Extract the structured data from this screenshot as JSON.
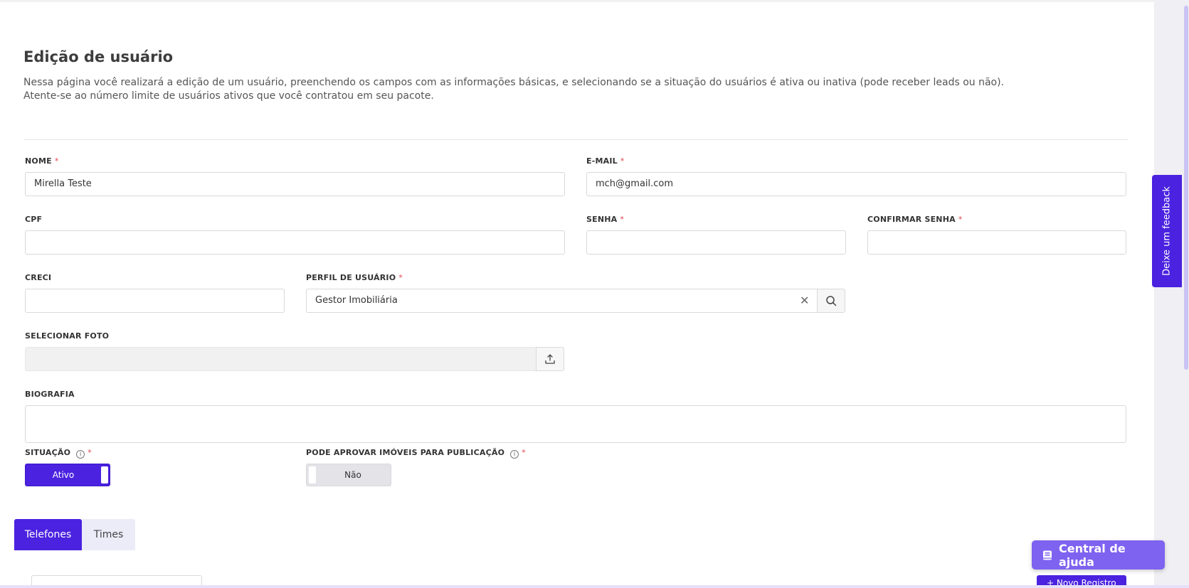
{
  "page": {
    "title": "Edição de usuário",
    "description_line1": "Nessa página você realizará a edição de um usuário, preenchendo os campos com as informações básicas, e selecionando se a situação do usuários é ativa ou inativa (pode receber leads ou não).",
    "description_line2": "Atente-se ao número limite de usuários ativos que você contratou em seu pacote."
  },
  "form": {
    "nome": {
      "label": "NOME",
      "value": "Mirella Teste",
      "required": "*"
    },
    "email": {
      "label": "E-MAIL",
      "value": "mch@gmail.com",
      "required": "*"
    },
    "cpf": {
      "label": "CPF",
      "value": ""
    },
    "senha": {
      "label": "SENHA",
      "value": "",
      "required": "*"
    },
    "confirmar_senha": {
      "label": "CONFIRMAR SENHA",
      "value": "",
      "required": "*"
    },
    "creci": {
      "label": "CRECI",
      "value": ""
    },
    "perfil": {
      "label": "PERFIL DE USUÁRIO",
      "value": "Gestor Imobiliária",
      "required": "*",
      "clear": "✕"
    },
    "foto": {
      "label": "SELECIONAR FOTO",
      "value": ""
    },
    "biografia": {
      "label": "BIOGRAFIA",
      "value": ""
    },
    "situacao": {
      "label": "SITUAÇÃO",
      "required": "*",
      "info": "i",
      "toggle_label": "Ativo",
      "state": "on"
    },
    "aprovar": {
      "label": "PODE APROVAR IMÓVEIS PARA PUBLICAÇÃO",
      "required": "*",
      "info": "i",
      "toggle_label": "Não",
      "state": "off"
    }
  },
  "tabs": [
    {
      "label": "Telefones",
      "active": true
    },
    {
      "label": "Times",
      "active": false
    }
  ],
  "partial_button": {
    "label": "+ Novo Registro"
  },
  "feedback": {
    "label": "Deixe um feedback"
  },
  "help": {
    "label": "Central de ajuda"
  },
  "colors": {
    "primary": "#4a22e0",
    "help": "#7e62f0",
    "required": "#e0464d"
  }
}
